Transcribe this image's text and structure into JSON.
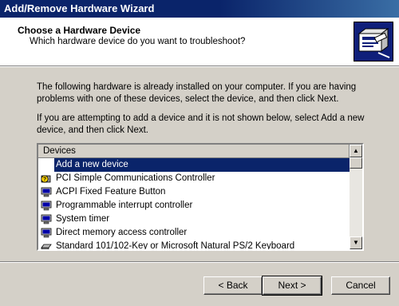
{
  "window": {
    "title": "Add/Remove Hardware Wizard"
  },
  "header": {
    "title": "Choose a Hardware Device",
    "subtitle": "Which hardware device do you want to troubleshoot?",
    "icon": "hardware-wizard-icon"
  },
  "body": {
    "para1": "The following hardware is already installed on your computer. If you are having problems with one of these devices, select the device, and then click Next.",
    "para2": "If you are attempting to add a device and it is not shown below, select Add a new device, and then click Next."
  },
  "devices": {
    "header": "Devices",
    "items": [
      {
        "label": "Add a new device",
        "icon": "none",
        "selected": true
      },
      {
        "label": "PCI Simple Communications Controller",
        "icon": "warning-device-icon"
      },
      {
        "label": "ACPI Fixed Feature Button",
        "icon": "computer-icon"
      },
      {
        "label": "Programmable interrupt controller",
        "icon": "computer-icon"
      },
      {
        "label": "System timer",
        "icon": "computer-icon"
      },
      {
        "label": "Direct memory access controller",
        "icon": "computer-icon"
      },
      {
        "label": "Standard 101/102-Key or Microsoft Natural PS/2 Keyboard",
        "icon": "keyboard-icon"
      }
    ]
  },
  "buttons": {
    "back": "< Back",
    "next": "Next >",
    "cancel": "Cancel"
  },
  "colors": {
    "titlebar": "#0a246a",
    "selection": "#0a246a",
    "dialog": "#d4d0c8"
  }
}
